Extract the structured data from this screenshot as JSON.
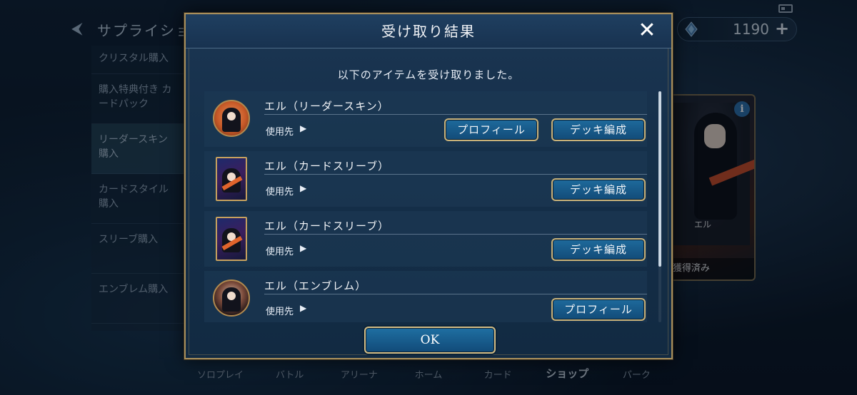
{
  "background": {
    "screen_title": "サプライショ",
    "currency_value": "1190",
    "side_menu": [
      "クリスタル購入",
      "購入特典付き カードパック",
      "リーダースキン 購入",
      "カードスタイル 購入",
      "スリーブ購入",
      "エンブレム購入"
    ],
    "card_name": "エル",
    "card_status": "獲得済み",
    "bottom_nav": [
      "ソロプレイ",
      "バトル",
      "アリーナ",
      "ホーム",
      "カード",
      "ショップ",
      "パーク"
    ]
  },
  "modal": {
    "title": "受け取り結果",
    "close_glyph": "✕",
    "message": "以下のアイテムを受け取りました。",
    "items": [
      {
        "name": "エル（リーダースキン）",
        "usage_label": "使用先",
        "buttons": [
          "プロフィール",
          "デッキ編成"
        ],
        "thumb_type": "skin"
      },
      {
        "name": "エル（カードスリーブ）",
        "usage_label": "使用先",
        "buttons": [
          "デッキ編成"
        ],
        "thumb_type": "sleeve"
      },
      {
        "name": "エル（カードスリーブ）",
        "usage_label": "使用先",
        "buttons": [
          "デッキ編成"
        ],
        "thumb_type": "sleeve"
      },
      {
        "name": "エル（エンブレム）",
        "usage_label": "使用先",
        "buttons": [
          "プロフィール"
        ],
        "thumb_type": "emblem"
      }
    ],
    "ok_label": "OK"
  },
  "colors": {
    "frame_gold": "#a88f5c",
    "button_blue": "#1e6a9c",
    "panel_bg": "#15304a"
  }
}
